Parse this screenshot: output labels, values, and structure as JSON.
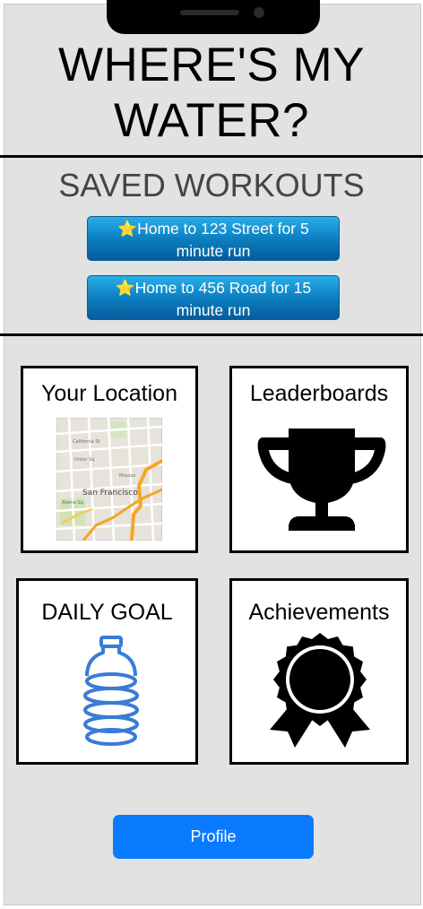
{
  "header": {
    "title_line1": "WHERE'S MY",
    "title_line2": "WATER?"
  },
  "saved_workouts": {
    "title": "SAVED WORKOUTS",
    "items": [
      {
        "icon": "star-icon",
        "line1": "⭐Home to 123 Street for 5",
        "line2": "minute run"
      },
      {
        "icon": "star-icon",
        "line1": "⭐Home to 456 Road for 15",
        "line2": "minute run"
      }
    ]
  },
  "tiles": {
    "location": {
      "label": "Your Location",
      "icon": "map-icon",
      "map_text": "San Francisco"
    },
    "leaderboards": {
      "label": "Leaderboards",
      "icon": "trophy-icon"
    },
    "daily_goal": {
      "label": "DAILY GOAL",
      "icon": "water-bottle-icon"
    },
    "achievements": {
      "label": "Achievements",
      "icon": "award-ribbon-icon"
    }
  },
  "profile": {
    "label": "Profile"
  },
  "colors": {
    "background": "#e2e2e2",
    "workout_button": "#0c7fc0",
    "profile_button": "#0a7aff",
    "bottle_stroke": "#3a7bd5"
  }
}
